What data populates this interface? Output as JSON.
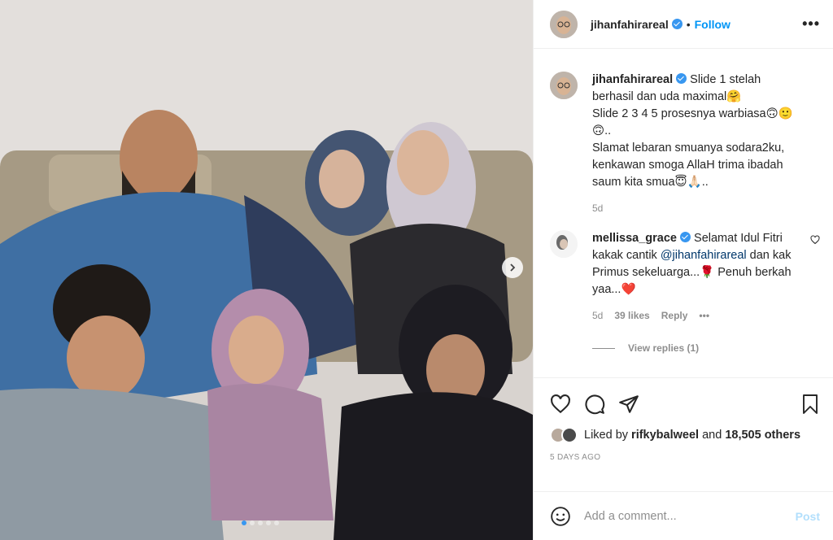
{
  "post": {
    "username": "jihanfahirareal",
    "follow_label": "Follow",
    "separator": "•",
    "more_label": "•••"
  },
  "caption": {
    "username": "jihanfahirareal",
    "text": "Slide 1 stelah berhasil dan uda maximal🤗\nSlide 2 3 4 5 prosesnya warbiasa🙃🙂🙃..\nSlamat lebaran smuanya sodara2ku, kenkawan smoga AllaH trima ibadah saum kita smua😇🙏🏻..",
    "age": "5d"
  },
  "comment": {
    "username": "mellissa_grace",
    "text_before": "Selamat Idul Fitri kakak cantik ",
    "mention": "@jihanfahirareal",
    "text_after": " dan kak Primus sekeluarga...🌹 Penuh berkah yaa...❤️",
    "age": "5d",
    "likes": "39 likes",
    "reply_label": "Reply",
    "more_label": "•••",
    "view_replies": "View replies (1)"
  },
  "likes": {
    "prefix": "Liked by ",
    "user": "rifkybalweel",
    "middle": " and ",
    "count": "18,505 others"
  },
  "timestamp": "5 DAYS AGO",
  "add_comment": {
    "placeholder": "Add a comment...",
    "post_label": "Post"
  },
  "carousel": {
    "slides": 5,
    "current": 1
  },
  "colors": {
    "accent": "#0095f6",
    "verified": "#3897f0",
    "muted": "#8e8e8e",
    "heart": "#ed4956"
  },
  "icons": [
    "next-arrow-icon",
    "heart-icon",
    "comment-icon",
    "share-icon",
    "bookmark-icon",
    "emoji-icon",
    "verified-icon",
    "like-comment-icon"
  ]
}
